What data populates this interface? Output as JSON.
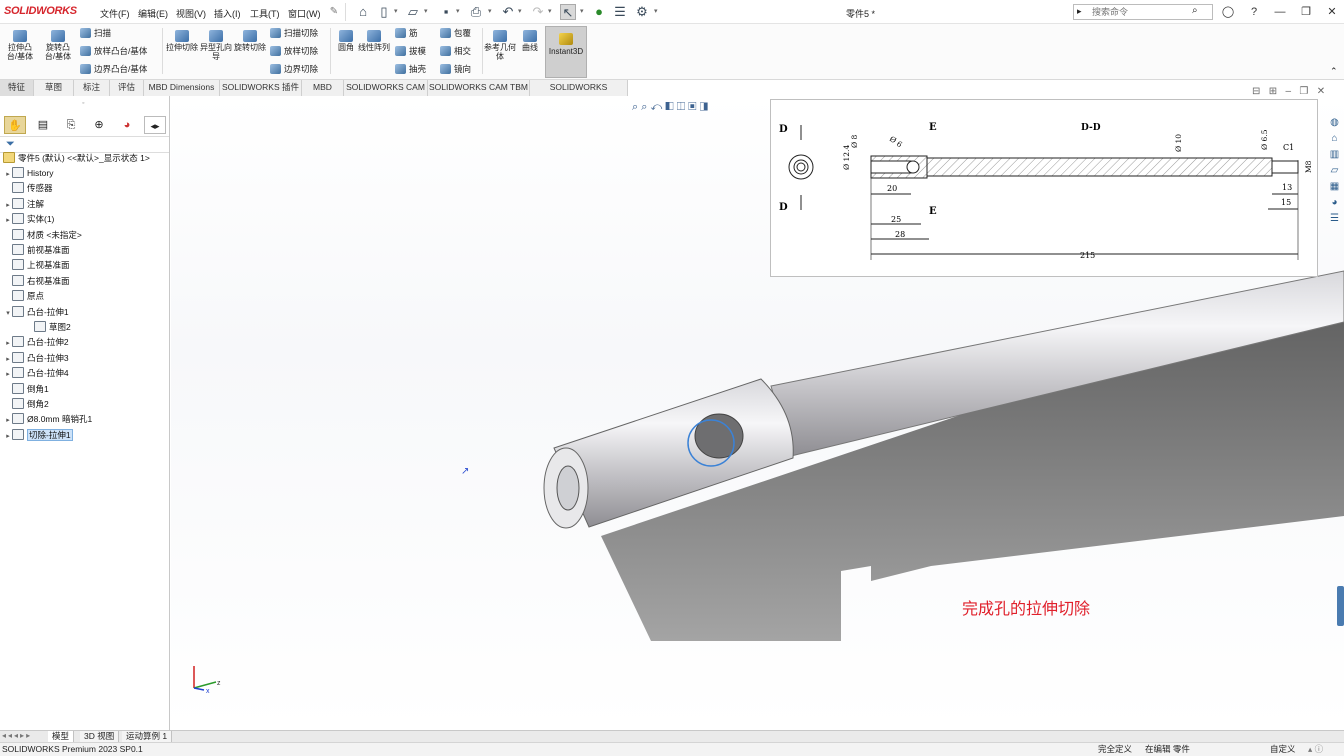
{
  "app": {
    "logo": "SOLIDWORKS",
    "doc_title": "零件5 *"
  },
  "menu": [
    "文件(F)",
    "编辑(E)",
    "视图(V)",
    "插入(I)",
    "工具(T)",
    "窗口(W)"
  ],
  "search": {
    "placeholder": "搜索命令"
  },
  "ribbon": {
    "extrude_boss": "拉伸凸台/基体",
    "revolve_boss": "旋转凸台/基体",
    "sweep": "扫描",
    "loft_boss": "放样凸台/基体",
    "boundary_boss": "边界凸台/基体",
    "extrude_cut": "拉伸切除",
    "hole_wizard": "异型孔向导",
    "revolve_cut": "旋转切除",
    "sweep_cut": "扫描切除",
    "loft_cut": "放样切除",
    "boundary_cut": "边界切除",
    "fillet": "圆角",
    "linear_pattern": "线性阵列",
    "rib": "筋",
    "draft": "拔模",
    "shell": "抽壳",
    "wrap": "包覆",
    "intersect": "相交",
    "mirror": "镜向",
    "ref_geometry": "参考几何体",
    "curves": "曲线",
    "instant3d": "Instant3D"
  },
  "tabs": [
    "特征",
    "草图",
    "标注",
    "评估",
    "MBD Dimensions",
    "SOLIDWORKS 插件",
    "MBD",
    "SOLIDWORKS CAM",
    "SOLIDWORKS CAM TBM",
    "SOLIDWORKS Inspection"
  ],
  "tree": {
    "root": "零件5 (默认) <<默认>_显示状态 1>",
    "items": [
      {
        "label": "History",
        "arrow": "▸"
      },
      {
        "label": "传感器",
        "arrow": ""
      },
      {
        "label": "注解",
        "arrow": "▸"
      },
      {
        "label": "实体(1)",
        "arrow": "▸"
      },
      {
        "label": "材质 <未指定>",
        "arrow": ""
      },
      {
        "label": "前视基准面",
        "arrow": ""
      },
      {
        "label": "上视基准面",
        "arrow": ""
      },
      {
        "label": "右视基准面",
        "arrow": ""
      },
      {
        "label": "原点",
        "arrow": ""
      },
      {
        "label": "凸台-拉伸1",
        "arrow": "▾"
      },
      {
        "label": "草图2",
        "arrow": ""
      },
      {
        "label": "凸台-拉伸2",
        "arrow": "▸"
      },
      {
        "label": "凸台-拉伸3",
        "arrow": "▸"
      },
      {
        "label": "凸台-拉伸4",
        "arrow": "▸"
      },
      {
        "label": "倒角1",
        "arrow": ""
      },
      {
        "label": "倒角2",
        "arrow": ""
      },
      {
        "label": "Ø8.0mm 暗销孔1",
        "arrow": "▸"
      },
      {
        "label": "切除-拉伸1",
        "arrow": "▸"
      }
    ]
  },
  "drawing": {
    "section_label": "D-D",
    "d_top": "D",
    "d_bottom": "D",
    "e_top": "E",
    "e_bottom": "E",
    "dim_phi8": "Ø 8",
    "dim_phi6": "Ø 6",
    "dim_phi12": "Ø 12.4",
    "dim_phi10": "Ø 10",
    "dim_phi65": "Ø 6.5",
    "dim_c1": "C1",
    "dim_m8": "M8",
    "dim_20": "20",
    "dim_25": "25",
    "dim_28": "28",
    "dim_215": "215",
    "dim_13": "13",
    "dim_15": "15"
  },
  "annotation": "完成孔的拉伸切除",
  "bottom_tabs": [
    "模型",
    "3D 视图",
    "运动算例 1"
  ],
  "status": {
    "version": "SOLIDWORKS Premium 2023 SP0.1",
    "defined": "完全定义",
    "editing": "在编辑 零件",
    "custom": "自定义"
  },
  "colors": {
    "brand": "#d6262d",
    "annotation": "#e0202b",
    "selection": "#cde2f8"
  }
}
